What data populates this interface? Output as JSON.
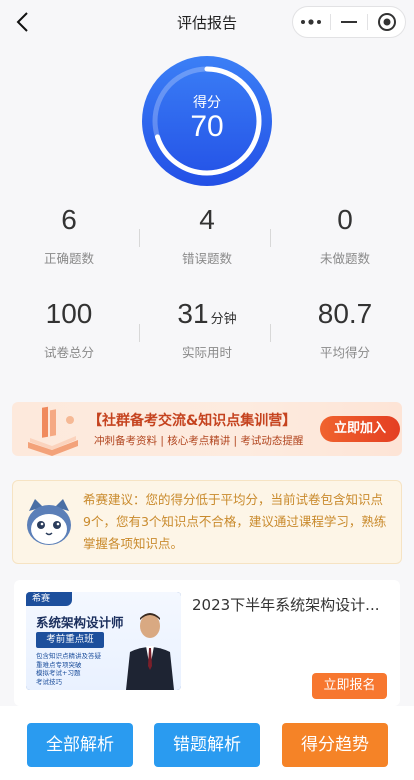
{
  "header": {
    "title": "评估报告",
    "back_icon": "chevron-left-icon",
    "capsule_icons": [
      "more-dots-icon",
      "minimize-icon",
      "close-target-icon"
    ]
  },
  "score": {
    "label": "得分",
    "value": "70",
    "progress_fraction": 0.7,
    "ring_color": "#2a67ef"
  },
  "stats_row1": [
    {
      "value": "6",
      "unit": "",
      "label": "正确题数"
    },
    {
      "value": "4",
      "unit": "",
      "label": "错误题数"
    },
    {
      "value": "0",
      "unit": "",
      "label": "未做题数"
    }
  ],
  "stats_row2": [
    {
      "value": "100",
      "unit": "",
      "label": "试卷总分"
    },
    {
      "value": "31",
      "unit": "分钟",
      "label": "实际用时"
    },
    {
      "value": "80.7",
      "unit": "",
      "label": "平均得分"
    }
  ],
  "banner": {
    "title": "【社群备考交流&知识点集训营】",
    "subtitle": "冲刺备考资料 | 核心考点精讲 | 考试动态提醒",
    "button": "立即加入"
  },
  "advice": {
    "text": "希赛建议：您的得分低于平均分，当前试卷包含知识点9个，您有3个知识点不合格，建议通过课程学习，熟练掌握各项知识点。"
  },
  "course": {
    "thumb_brand": "希赛",
    "thumb_title": "系统架构设计师",
    "thumb_tag": "考前重点班",
    "thumb_lines": [
      "包含知识点精讲及答疑",
      "重难点专项突破",
      "模拟考试+习题",
      "考试技巧"
    ],
    "title": "2023下半年系统架构设计...",
    "button": "立即报名"
  },
  "actions": [
    {
      "label": "全部解析",
      "color": "#2a9bf0"
    },
    {
      "label": "错题解析",
      "color": "#2a9bf0"
    },
    {
      "label": "得分趋势",
      "color": "#f58327"
    }
  ]
}
